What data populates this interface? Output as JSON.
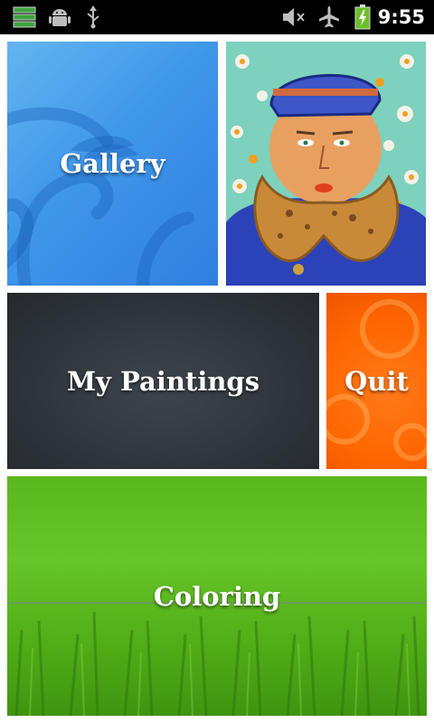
{
  "status_bar": {
    "time": "9:55",
    "icons": [
      "storage-icon",
      "android-debug-icon",
      "usb-icon",
      "muted-icon",
      "airplane-mode-icon",
      "battery-charging-icon"
    ]
  },
  "tiles": {
    "gallery": {
      "label": "Gallery"
    },
    "portrait": {
      "icon": "painting-thumbnail-icon"
    },
    "my_paintings": {
      "label": "My Paintings"
    },
    "quit": {
      "label": "Quit"
    },
    "coloring": {
      "label": "Coloring"
    }
  },
  "colors": {
    "gallery_blue": "#3f97e9",
    "paintings_dark": "#2e343a",
    "quit_orange": "#ff6600",
    "coloring_green": "#58b81d"
  }
}
